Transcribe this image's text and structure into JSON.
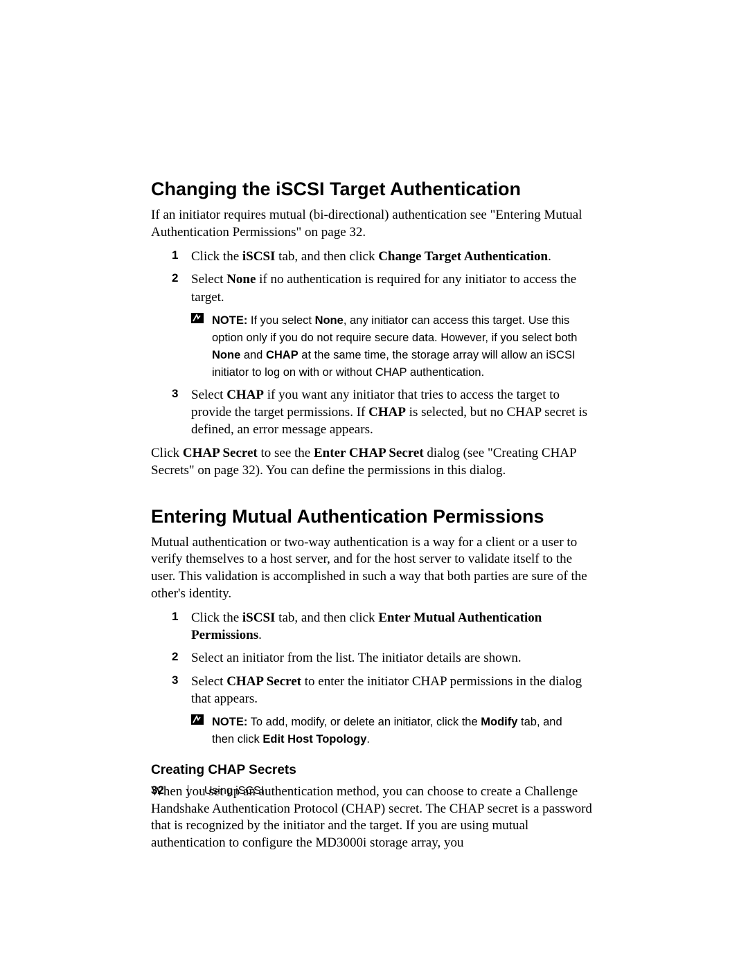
{
  "section1": {
    "heading": "Changing the iSCSI Target Authentication",
    "intro": "If an initiator requires mutual (bi-directional) authentication see \"Entering Mutual Authentication Permissions\" on page 32.",
    "steps": [
      {
        "num": "1",
        "pre": "Click the ",
        "b1": "iSCSI",
        "mid": " tab, and then click ",
        "b2": "Change Target Authentication",
        "post": "."
      },
      {
        "num": "2",
        "pre": "Select ",
        "b1": "None",
        "post": " if no authentication is required for any initiator to access the target."
      },
      {
        "num": "3",
        "pre": "Select ",
        "b1": "CHAP",
        "mid": " if you want any initiator that tries to access the target to provide the target permissions. If ",
        "b2": "CHAP",
        "post": " is selected, but no CHAP secret is defined, an error message appears."
      }
    ],
    "note": {
      "label": "NOTE:",
      "pre": " If you select ",
      "b1": "None",
      "mid1": ", any initiator can access this target. Use this option only if you do not require secure data. However, if you select both ",
      "b2": "None",
      "mid2": " and ",
      "b3": "CHAP",
      "post": " at the same time, the storage array will allow an iSCSI initiator to log on with or without CHAP authentication."
    },
    "after_pre": "Click ",
    "after_b1": "CHAP Secret",
    "after_mid": " to see the ",
    "after_b2": "Enter CHAP Secret",
    "after_post": " dialog (see \"Creating CHAP Secrets\" on page 32). You can define the permissions in this dialog."
  },
  "section2": {
    "heading": "Entering Mutual Authentication Permissions",
    "intro": "Mutual authentication or two-way authentication is a way for a client or a user to verify themselves to a host server, and for the host server to validate itself to the user. This validation is accomplished in such a way that both parties are sure of the other's identity.",
    "steps": [
      {
        "num": "1",
        "pre": "Click the ",
        "b1": "iSCSI",
        "mid": " tab, and then click ",
        "b2": "Enter Mutual Authentication Permissions",
        "post": "."
      },
      {
        "num": "2",
        "text": "Select an initiator from the list. The initiator details are shown."
      },
      {
        "num": "3",
        "pre": "Select ",
        "b1": "CHAP Secret",
        "post": " to enter the initiator CHAP permissions in the dialog that appears."
      }
    ],
    "note": {
      "label": "NOTE:",
      "pre": " To add, modify, or delete an initiator, click the ",
      "b1": "Modify",
      "mid": " tab, and then click ",
      "b2": "Edit Host Topology",
      "post": "."
    }
  },
  "section3": {
    "heading": "Creating CHAP Secrets",
    "body": "When you set up an authentication method, you can choose to create a Challenge Handshake Authentication Protocol (CHAP) secret. The CHAP secret is a password that is recognized by the initiator and the target. If you are using mutual authentication to configure the MD3000i storage array, you"
  },
  "footer": {
    "page": "32",
    "title": "Using iSCSI"
  }
}
